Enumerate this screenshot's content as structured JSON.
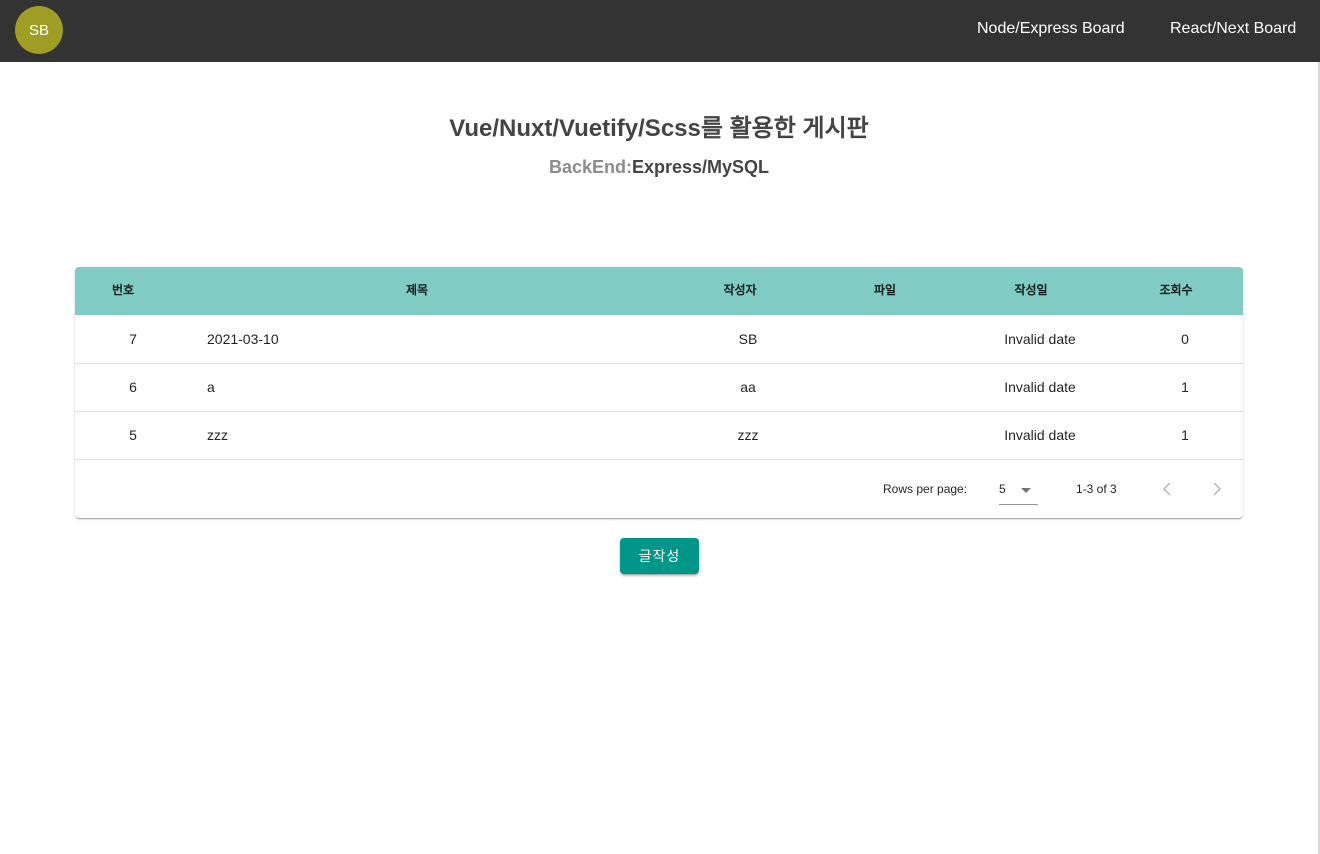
{
  "header": {
    "avatar_text": "SB",
    "avatar_color": "#9e9d24",
    "bar_color": "#333333",
    "nav": [
      {
        "label": "Node/Express Board"
      },
      {
        "label": "React/Next Board"
      }
    ]
  },
  "page": {
    "title": "Vue/Nuxt/Vuetify/Scss를 활용한 게시판",
    "subtitle_label": "BackEnd:",
    "subtitle_value": "Express/MySQL"
  },
  "table": {
    "header_color": "#80cbc4",
    "columns": [
      "번호",
      "제목",
      "작성자",
      "파일",
      "작성일",
      "조회수"
    ],
    "rows": [
      {
        "no": "7",
        "title": "2021-03-10",
        "author": "SB",
        "file": "",
        "date": "Invalid date",
        "views": "0"
      },
      {
        "no": "6",
        "title": "a",
        "author": "aa",
        "file": "",
        "date": "Invalid date",
        "views": "1"
      },
      {
        "no": "5",
        "title": "zzz",
        "author": "zzz",
        "file": "",
        "date": "Invalid date",
        "views": "1"
      }
    ],
    "footer": {
      "rows_per_page_label": "Rows per page:",
      "rows_per_page_value": "5",
      "page_range": "1-3 of 3",
      "prev_icon": "chevron-left-icon",
      "next_icon": "chevron-right-icon"
    }
  },
  "actions": {
    "write_label": "글작성",
    "write_color": "#009688"
  }
}
